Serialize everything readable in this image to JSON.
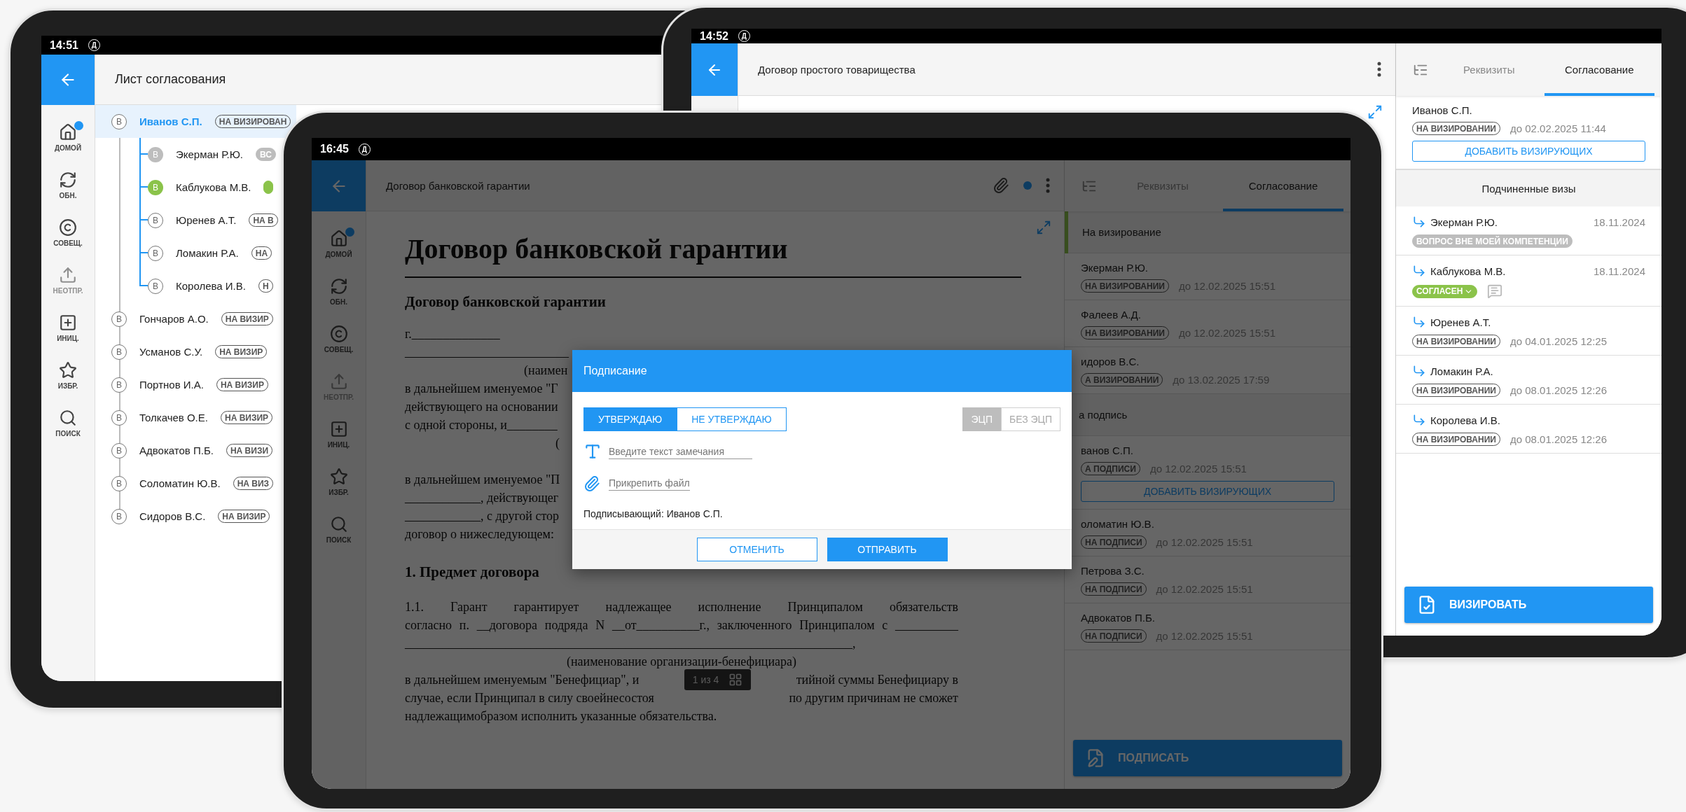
{
  "back_left_tablet": {
    "status_bar": {
      "time": "14:51",
      "icon": "Д"
    },
    "title": "Лист согласования",
    "sidebar": [
      {
        "kind": "home",
        "label": "ДОМОЙ",
        "disabled": false,
        "notification": true
      },
      {
        "kind": "refresh",
        "label": "ОБН.",
        "disabled": false,
        "notification": false
      },
      {
        "kind": "meeting",
        "label": "СОВЕЩ.",
        "disabled": false,
        "notification": false
      },
      {
        "kind": "outbox",
        "label": "НЕОТПР.",
        "disabled": true,
        "notification": false
      },
      {
        "kind": "new",
        "label": "ИНИЦ.",
        "disabled": false,
        "notification": false
      },
      {
        "kind": "favorites",
        "label": "ИЗБР.",
        "disabled": false,
        "notification": false
      },
      {
        "kind": "search",
        "label": "ПОИСК",
        "disabled": false,
        "notification": false
      }
    ],
    "tree": [
      {
        "mark": "В",
        "kind": "pending",
        "name": "Иванов С.П.",
        "selected": true,
        "badge": {
          "kind": "pending",
          "text": "НА ВИЗИРОВАН"
        },
        "children": [
          {
            "mark": "В",
            "kind": "info",
            "name": "Экерман Р.Ю.",
            "selected": false,
            "badge": {
              "kind": "info",
              "text": "ВС"
            }
          },
          {
            "mark": "В",
            "kind": "agreed",
            "name": "Каблукова М.В.",
            "selected": false,
            "badge": {
              "kind": "agreed"
            }
          },
          {
            "mark": "В",
            "kind": "pending",
            "name": "Юренев А.Т.",
            "selected": false,
            "badge": {
              "kind": "pending",
              "text": "НА В"
            }
          },
          {
            "mark": "В",
            "kind": "pending",
            "name": "Ломакин Р.А.",
            "selected": false,
            "badge": {
              "kind": "pending",
              "text": "НА"
            }
          },
          {
            "mark": "В",
            "kind": "pending",
            "name": "Королева И.В.",
            "selected": false,
            "badge": {
              "kind": "pending",
              "text": "Н"
            }
          }
        ]
      },
      {
        "mark": "В",
        "kind": "pending",
        "name": "Гончаров А.О.",
        "selected": false,
        "badge": {
          "kind": "pending",
          "text": "НА ВИЗИР"
        }
      },
      {
        "mark": "В",
        "kind": "pending",
        "name": "Усманов С.У.",
        "selected": false,
        "badge": {
          "kind": "pending",
          "text": "НА ВИЗИР"
        }
      },
      {
        "mark": "В",
        "kind": "pending",
        "name": "Портнов И.А.",
        "selected": false,
        "badge": {
          "kind": "pending",
          "text": "НА ВИЗИР"
        }
      },
      {
        "mark": "В",
        "kind": "pending",
        "name": "Толкачев О.Е.",
        "selected": false,
        "badge": {
          "kind": "pending",
          "text": "НА ВИЗИР"
        }
      },
      {
        "mark": "В",
        "kind": "pending",
        "name": "Адвокатов П.Б.",
        "selected": false,
        "badge": {
          "kind": "pending",
          "text": "НА ВИЗИ"
        }
      },
      {
        "mark": "В",
        "kind": "pending",
        "name": "Соломатин Ю.В.",
        "selected": false,
        "badge": {
          "kind": "pending",
          "text": "НА ВИЗ"
        }
      },
      {
        "mark": "В",
        "kind": "pending",
        "name": "Сидоров В.С.",
        "selected": false,
        "badge": {
          "kind": "pending",
          "text": "НА ВИЗИР"
        }
      }
    ]
  },
  "back_right_tablet": {
    "status_bar": {
      "time": "14:52",
      "icon": "Д"
    },
    "title": "Договор простого товарищества",
    "panel": {
      "tabs": [
        {
          "kind": "icon",
          "selected": false
        },
        {
          "kind": "text",
          "label": "Реквизиты",
          "selected": false
        },
        {
          "kind": "text",
          "label": "Согласование",
          "selected": true
        }
      ],
      "approver": {
        "name": "Иванов С.П.",
        "badge": {
          "kind": "pending",
          "text": "НА ВИЗИРОВАНИИ"
        },
        "due": "до 02.02.2025 11:44",
        "action": "ДОБАВИТЬ ВИЗИРУЮЩИХ"
      },
      "subheader": "Подчиненные визы",
      "rows": [
        {
          "name": "Экерман Р.Ю.",
          "date": "18.11.2024",
          "badge": {
            "kind": "info",
            "text": "ВОПРОС ВНЕ МОЕЙ КОМПЕТЕНЦИИ",
            "dropdown": false
          },
          "comment": false
        },
        {
          "name": "Каблукова М.В.",
          "date": "18.11.2024",
          "badge": {
            "kind": "agreed",
            "text": "СОГЛАСЕН",
            "dropdown": true
          },
          "comment": true
        },
        {
          "name": "Юренев А.Т.",
          "badge": {
            "kind": "pending",
            "text": "НА ВИЗИРОВАНИИ",
            "dropdown": false
          },
          "due": "до 04.01.2025 12:25",
          "comment": false
        },
        {
          "name": "Ломакин Р.А.",
          "badge": {
            "kind": "pending",
            "text": "НА ВИЗИРОВАНИИ",
            "dropdown": false
          },
          "due": "до 08.01.2025 12:26",
          "comment": false
        },
        {
          "name": "Королева И.В.",
          "badge": {
            "kind": "pending",
            "text": "НА ВИЗИРОВАНИИ",
            "dropdown": false
          },
          "due": "до 08.01.2025 12:26",
          "comment": false
        }
      ],
      "primary_button": "ВИЗИРОВАТЬ"
    }
  },
  "front_tablet": {
    "status_bar": {
      "time": "16:45",
      "icon": "Д"
    },
    "title": "Договор банковской гарантии",
    "indicator": true,
    "sidebar": [
      {
        "kind": "home",
        "label": "ДОМОЙ",
        "disabled": false,
        "notification": true
      },
      {
        "kind": "refresh",
        "label": "ОБН.",
        "disabled": false,
        "notification": false
      },
      {
        "kind": "meeting",
        "label": "СОВЕЩ.",
        "disabled": false,
        "notification": false
      },
      {
        "kind": "outbox",
        "label": "НЕОТПР.",
        "disabled": true,
        "notification": false
      },
      {
        "kind": "new",
        "label": "ИНИЦ.",
        "disabled": false,
        "notification": false
      },
      {
        "kind": "favorites",
        "label": "ИЗБР.",
        "disabled": false,
        "notification": false
      },
      {
        "kind": "search",
        "label": "ПОИСК",
        "disabled": false,
        "notification": false
      }
    ],
    "document": {
      "title": "Договор банковской гарантии",
      "subtitle": "Договор банковской гарантии",
      "blocks": [
        {
          "kind": "line",
          "text": "г.______________"
        },
        {
          "kind": "line",
          "text": "__________________________"
        },
        {
          "kind": "caption",
          "text": "(наимен"
        },
        {
          "kind": "line",
          "text": "в дальнейшем именуемое \"Г"
        },
        {
          "kind": "line",
          "text": "действующего на основании"
        },
        {
          "kind": "line",
          "text": "с одной стороны, и________"
        },
        {
          "kind": "mark",
          "text": "("
        },
        {
          "kind": "gap"
        },
        {
          "kind": "line",
          "text": "в дальнейшем именуемое \"П"
        },
        {
          "kind": "line",
          "text": "____________, действующег"
        },
        {
          "kind": "line",
          "text": "____________, с другой стор"
        },
        {
          "kind": "line",
          "text": "договор о нижеследующем:"
        },
        {
          "kind": "heading",
          "text": "1. Предмет договора"
        },
        {
          "kind": "justified",
          "text": "1.1.      Гарант гарантирует надлежащее исполнение Принципалом обязательств"
        },
        {
          "kind": "justified",
          "text": "согласно п. __договора подряда N __от__________г., заключенного Принципалом с __________"
        },
        {
          "kind": "justified",
          "text": "_______________________________________________________________________,"
        },
        {
          "kind": "center",
          "text": "(наименование организации-бенефициара)"
        },
        {
          "kind": "split",
          "left": "в дальнейшем именуемым \"Бенефициар\", и",
          "right": "тийной суммы Бенефициару в"
        },
        {
          "kind": "split",
          "left": "случае, если Принципал в силу своейнесостоя",
          "right": "по другим причинам не сможет"
        },
        {
          "kind": "line",
          "text": "надлежащимобразом исполнить указанные обязательства."
        }
      ],
      "pager": "1 из 4"
    },
    "panel": {
      "tabs": [
        {
          "kind": "icon",
          "selected": false
        },
        {
          "kind": "text",
          "label": "Реквизиты",
          "selected": false
        },
        {
          "kind": "text",
          "label": "Согласование",
          "selected": true
        }
      ],
      "sections": [
        {
          "title": "На визирование",
          "color": "#384e1e",
          "rows": [
            {
              "name": "Экерман Р.Ю.",
              "badge": {
                "kind": "pending",
                "text": "НА ВИЗИРОВАНИИ"
              },
              "due": "до 12.02.2025 15:51"
            },
            {
              "name": "Фалеев А.Д.",
              "badge": {
                "kind": "pending",
                "text": "НА ВИЗИРОВАНИИ"
              },
              "due": "до 12.02.2025 15:51"
            },
            {
              "name": "идоров В.С.",
              "badge": {
                "kind": "pending",
                "text": "А ВИЗИРОВАНИИ"
              },
              "due": "до 13.02.2025 17:59"
            }
          ]
        },
        {
          "title": "а подпись",
          "rows": [
            {
              "name": "ванов С.П.",
              "badge": {
                "kind": "pending",
                "text": "А ПОДПИСИ"
              },
              "due": "до 12.02.2025 15:51",
              "action": "ДОБАВИТЬ ВИЗИРУЮЩИХ"
            },
            {
              "name": "оломатин Ю.В.",
              "badge": {
                "kind": "pending",
                "text": "НА ПОДПИСИ"
              },
              "due": "до 12.02.2025 15:51"
            },
            {
              "name": "Петрова З.С.",
              "badge": {
                "kind": "pending",
                "text": "НА ПОДПИСИ"
              },
              "due": "до 12.02.2025 15:51"
            },
            {
              "name": "Адвокатов П.Б.",
              "badge": {
                "kind": "pending",
                "text": "НА ПОДПИСИ"
              },
              "due": "до 12.02.2025 15:51"
            }
          ]
        }
      ],
      "primary_button": "ПОДПИСАТЬ"
    },
    "dialog": {
      "title": "Подписание",
      "decision": [
        {
          "label": "УТВЕРЖДАЮ",
          "selected": true
        },
        {
          "label": "НЕ УТВЕРЖДАЮ",
          "selected": false
        }
      ],
      "signature": [
        {
          "label": "ЭЦП",
          "selected": true
        },
        {
          "label": "БЕЗ ЭЦП",
          "selected": false
        }
      ],
      "comment_placeholder": "Введите текст замечания",
      "attach_link": "Прикрепить файл",
      "signer": "Подписывающий: Иванов С.П.",
      "buttons": [
        {
          "kind": "secondary",
          "label": "ОТМЕНИТЬ"
        },
        {
          "kind": "primary",
          "label": "ОТПРАВИТЬ"
        }
      ]
    }
  }
}
